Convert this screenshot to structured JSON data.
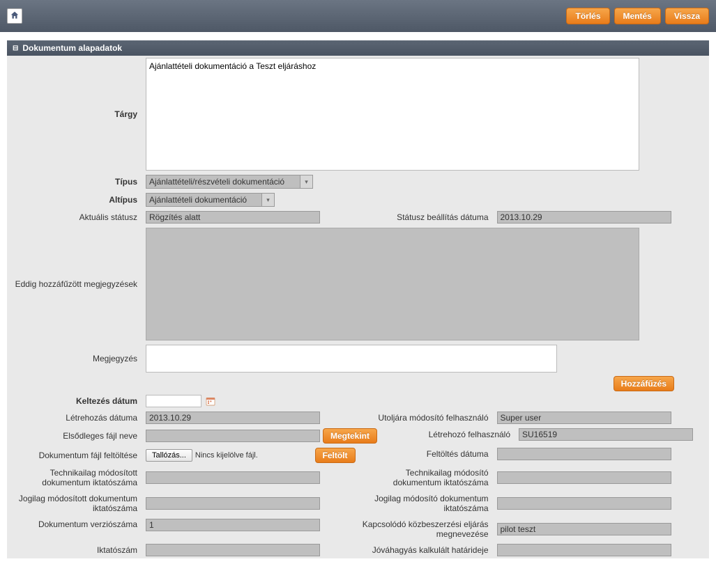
{
  "topbar": {
    "delete_label": "Törlés",
    "save_label": "Mentés",
    "back_label": "Vissza"
  },
  "panel": {
    "title": "Dokumentum alapadatok"
  },
  "labels": {
    "targy": "Tárgy",
    "tipus": "Típus",
    "altipus": "Altípus",
    "aktualis_statusz": "Aktuális státusz",
    "statusz_beallitas_datuma": "Státusz beállítás dátuma",
    "eddig_hozzafuzott": "Eddig hozzáfűzött megjegyzések",
    "megjegyzes": "Megjegyzés",
    "keltezes_datum": "Keltezés dátum",
    "letrehozas_datuma": "Létrehozás dátuma",
    "utoljara_modosito": "Utoljára módosító felhasználó",
    "elsodleges_fajl_neve": "Elsődleges fájl neve",
    "letrehozo_felhasznalo": "Létrehozó felhasználó",
    "dokumentum_fajl_feltoltese": "Dokumentum fájl feltöltése",
    "feltoltes_datuma": "Feltöltés dátuma",
    "tech_modositott": "Technikailag módosított dokumentum iktatószáma",
    "tech_modosito": "Technikailag módosító dokumentum iktatószáma",
    "jogilag_modositott": "Jogilag módosított dokumentum iktatószáma",
    "jogilag_modosito": "Jogilag módosító dokumentum iktatószáma",
    "dokumentum_verzioszama": "Dokumentum verziószáma",
    "kapcsolodo_eljaras": "Kapcsolódó közbeszerzési eljárás megnevezése",
    "iktatoszam": "Iktatószám",
    "jovahagyas_hatarideje": "Jóváhagyás kalkulált határideje"
  },
  "values": {
    "targy": "Ajánlattételi dokumentáció a Teszt eljáráshoz",
    "tipus": "Ajánlattételi/részvételi dokumentáció",
    "altipus": "Ajánlattételi dokumentáció",
    "aktualis_statusz": "Rögzítés alatt",
    "statusz_beallitas_datuma": "2013.10.29",
    "eddig_hozzafuzott": "",
    "megjegyzes": "",
    "keltezes_datum": "",
    "letrehozas_datuma": "2013.10.29",
    "utoljara_modosito": "Super user",
    "elsodleges_fajl_neve": "",
    "letrehozo_felhasznalo": "SU16519",
    "feltoltes_datuma": "",
    "tech_modositott": "",
    "tech_modosito": "",
    "jogilag_modositott": "",
    "jogilag_modosito": "",
    "dokumentum_verzioszama": "1",
    "kapcsolodo_eljaras": "pilot teszt",
    "iktatoszam": "",
    "jovahagyas_hatarideje": ""
  },
  "buttons": {
    "hozzafuzes": "Hozzáfűzés",
    "megtekint": "Megtekint",
    "feltolt": "Feltölt",
    "tallozas": "Tallózás...",
    "nincs_fajl": "Nincs kijelölve fájl."
  }
}
